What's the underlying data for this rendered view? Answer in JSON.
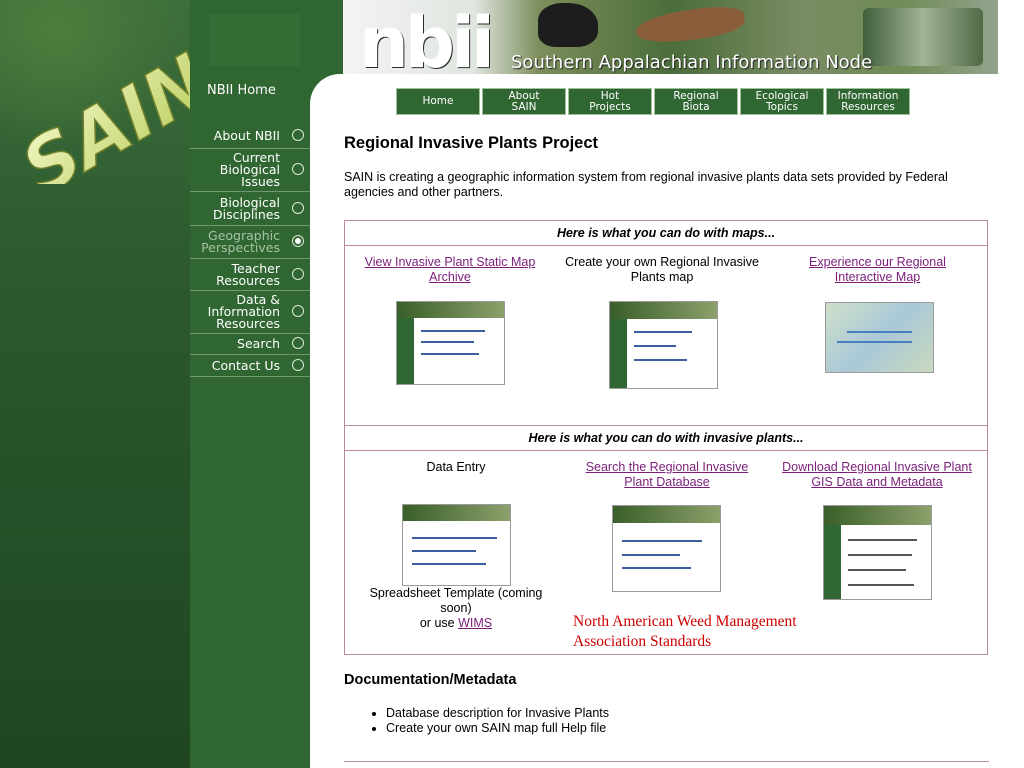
{
  "logo": {
    "text": "SAIN"
  },
  "nav": {
    "home": "NBII Home",
    "items": [
      {
        "label": "About NBII",
        "state": "off"
      },
      {
        "label": "Current Biological Issues",
        "state": "off"
      },
      {
        "label": "Biological Disciplines",
        "state": "off"
      },
      {
        "label": "Geographic Perspectives",
        "state": "on"
      },
      {
        "label": "Teacher Resources",
        "state": "off"
      },
      {
        "label": "Data & Information Resources",
        "state": "off"
      },
      {
        "label": "Search",
        "state": "off"
      },
      {
        "label": "Contact Us",
        "state": "off"
      }
    ]
  },
  "banner": {
    "nbii": "nbii",
    "subtitle": "Southern Appalachian Information Node"
  },
  "topnav": [
    {
      "label": "Home"
    },
    {
      "label": "About SAIN"
    },
    {
      "label": "Hot Projects"
    },
    {
      "label": "Regional Biota"
    },
    {
      "label": "Ecological Topics"
    },
    {
      "label": "Information Resources"
    }
  ],
  "page": {
    "title": "Regional Invasive Plants Project",
    "intro": "SAIN is creating a geographic information system from regional invasive plants data sets provided by Federal agencies and other partners."
  },
  "maps_panel": {
    "heading": "Here is what you can do with maps...",
    "col1_link": "View Invasive Plant Static Map Archive",
    "col2_text": "Create your own Regional Invasive Plants map",
    "col3_link": "Experience our Regional Interactive Map"
  },
  "plants_panel": {
    "heading": "Here is what you can do with invasive plants...",
    "col1_text": "Data Entry",
    "col1_caption": "Spreadsheet Template (coming soon)",
    "col1_or": "or use",
    "col1_link": "WIMS",
    "col2_link": "Search the Regional Invasive Plant Database",
    "col2_red": "North American Weed Management Association Standards",
    "col3_link": "Download Regional Invasive Plant GIS Data and Metadata"
  },
  "doc": {
    "title": "Documentation/Metadata",
    "items": [
      "Database description for Invasive Plants",
      "Create your own SAIN map full Help file"
    ]
  },
  "colors": {
    "nav_green": "#2f6631",
    "link": "#7a1f7a",
    "border": "#b88a9c",
    "red_text": "#cc0000"
  },
  "icons": [
    "radio-circle-icon"
  ]
}
